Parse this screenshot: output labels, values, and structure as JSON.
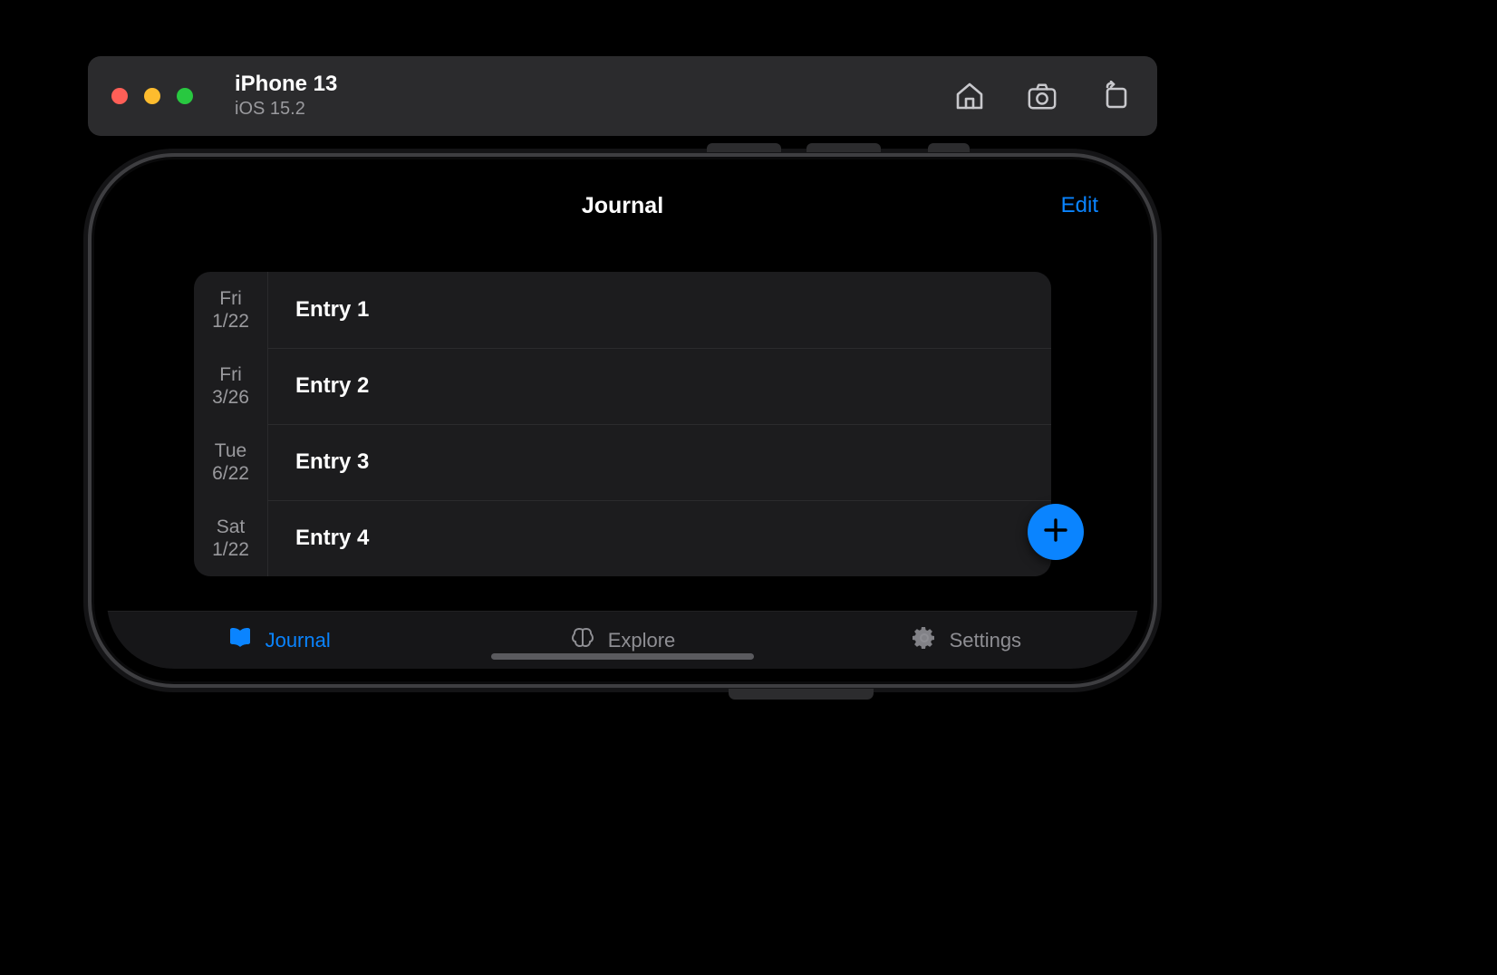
{
  "simulator": {
    "device": "iPhone 13",
    "os": "iOS 15.2"
  },
  "nav": {
    "title": "Journal",
    "edit_label": "Edit"
  },
  "entries": [
    {
      "day": "Fri",
      "date": "1/22",
      "title": "Entry 1"
    },
    {
      "day": "Fri",
      "date": "3/26",
      "title": "Entry 2"
    },
    {
      "day": "Tue",
      "date": "6/22",
      "title": "Entry 3"
    },
    {
      "day": "Sat",
      "date": "1/22",
      "title": "Entry 4"
    }
  ],
  "tabs": {
    "journal": "Journal",
    "explore": "Explore",
    "settings": "Settings"
  },
  "colors": {
    "accent": "#0a84ff",
    "card_bg": "#1c1c1e",
    "bar_bg": "#2b2b2d"
  }
}
